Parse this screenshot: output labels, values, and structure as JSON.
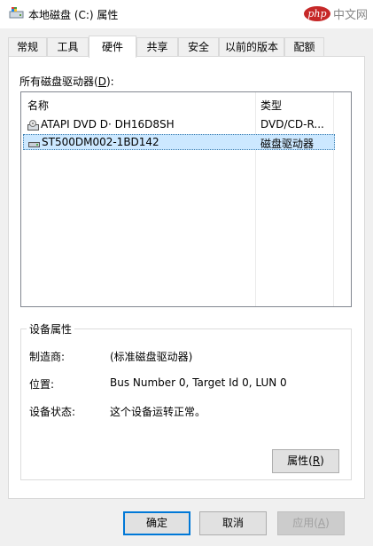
{
  "window": {
    "title": "本地磁盘 (C:) 属性"
  },
  "watermark": {
    "logo": "php",
    "text": "中文网"
  },
  "tabs": [
    {
      "label": "常规"
    },
    {
      "label": "工具"
    },
    {
      "label": "硬件"
    },
    {
      "label": "共享"
    },
    {
      "label": "安全"
    },
    {
      "label": "以前的版本"
    },
    {
      "label": "配额"
    }
  ],
  "active_tab": "硬件",
  "drives": {
    "label_pre": "所有磁盘驱动器(",
    "label_key": "D",
    "label_post": "):",
    "columns": {
      "name": "名称",
      "type": "类型"
    },
    "rows": [
      {
        "name": "ATAPI DVD D· DH16D8SH",
        "type": "DVD/CD-R...",
        "icon": "optical-drive-icon"
      },
      {
        "name": "ST500DM002-1BD142",
        "type": "磁盘驱动器",
        "icon": "hard-disk-icon"
      }
    ]
  },
  "device": {
    "group_title": "设备属性",
    "manufacturer_label": "制造商:",
    "manufacturer_value": "(标准磁盘驱动器)",
    "location_label": "位置:",
    "location_value": "Bus Number 0, Target Id 0, LUN 0",
    "status_label": "设备状态:",
    "status_value": "这个设备运转正常。",
    "properties_button_pre": "属性(",
    "properties_button_key": "R",
    "properties_button_post": ")"
  },
  "buttons": {
    "ok": "确定",
    "cancel": "取消",
    "apply_pre": "应用(",
    "apply_key": "A",
    "apply_post": ")"
  }
}
